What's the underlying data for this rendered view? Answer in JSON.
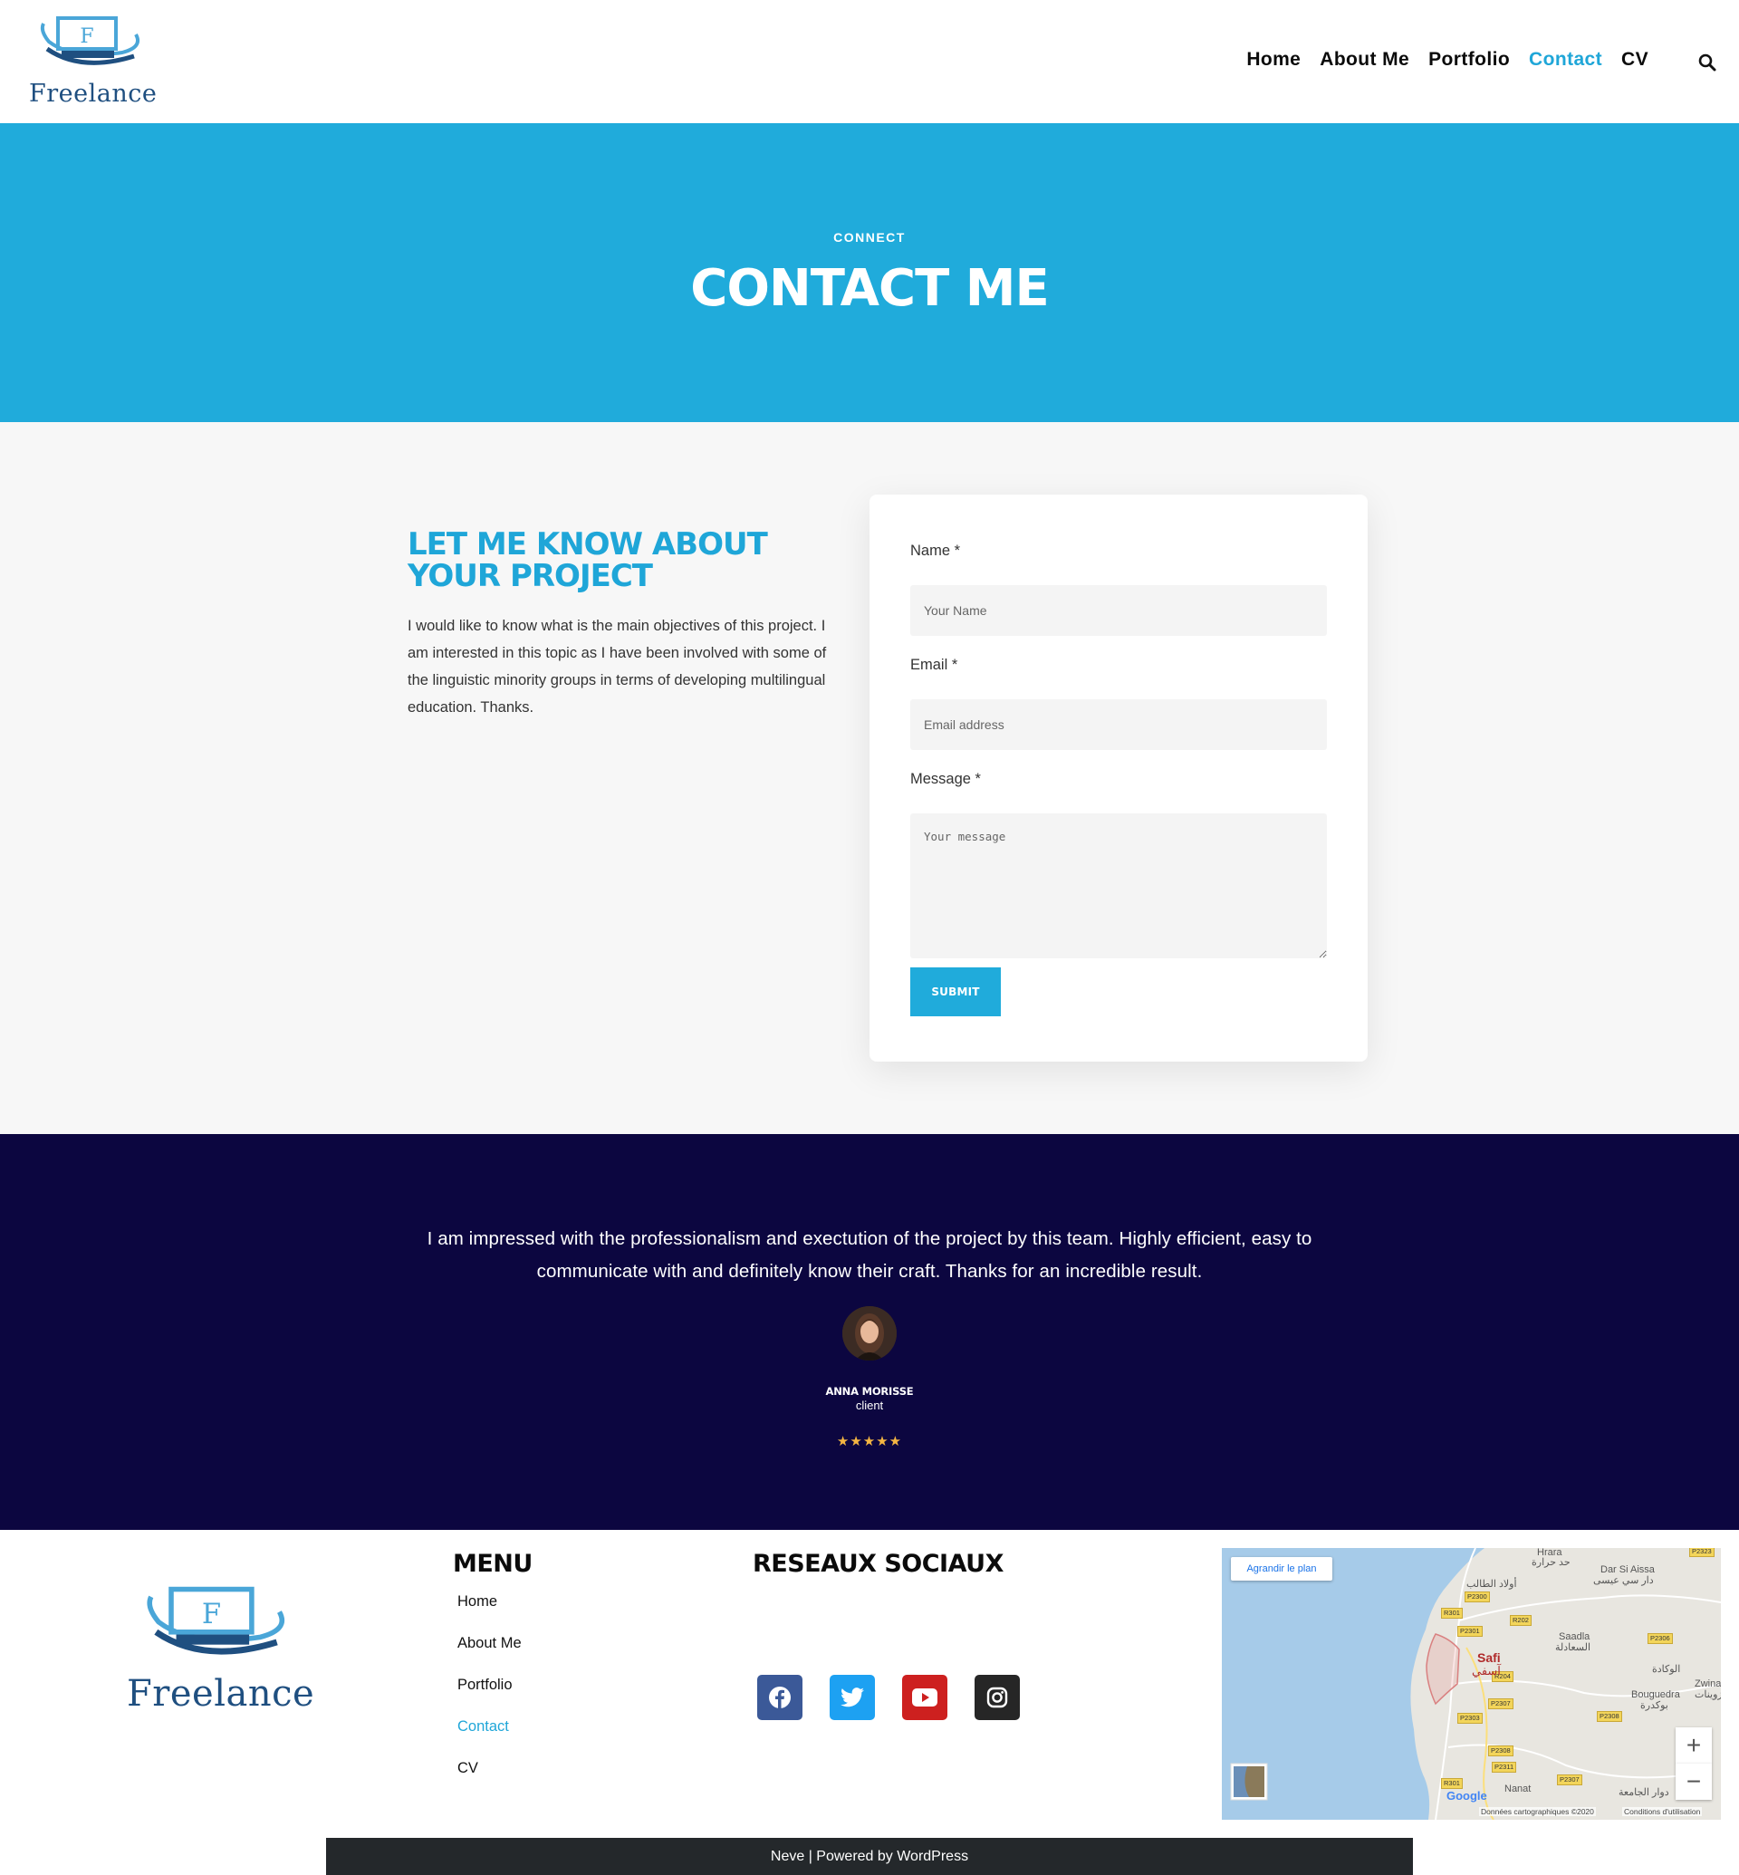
{
  "header": {
    "logo_letter": "F",
    "logo_text": "Freelance",
    "nav": [
      {
        "label": "Home",
        "active": false
      },
      {
        "label": "About Me",
        "active": false
      },
      {
        "label": "Portfolio",
        "active": false
      },
      {
        "label": "Contact",
        "active": true
      },
      {
        "label": "CV",
        "active": false
      }
    ]
  },
  "hero": {
    "kicker": "CONNECT",
    "title": "CONTACT ME"
  },
  "contact": {
    "title": "LET ME KNOW ABOUT YOUR PROJECT",
    "text": "I would like to know what is the main objectives of this project. I am interested in this topic as I have been involved with some of the linguistic minority groups in terms of developing multilingual education. Thanks.",
    "form": {
      "name_label": "Name *",
      "name_placeholder": "Your Name",
      "email_label": "Email *",
      "email_placeholder": "Email address",
      "message_label": "Message *",
      "message_placeholder": "Your message",
      "submit_label": "SUBMIT"
    }
  },
  "testimonial": {
    "quote": "I am impressed with the professionalism and exectution of the project by this team. Highly efficient, easy to communicate with and definitely know their craft. Thanks for an incredible result.",
    "name": "ANNA MORISSE",
    "role": "client",
    "stars": "★★★★★",
    "rating": 5
  },
  "footer": {
    "logo_letter": "F",
    "logo_text": "Freelance",
    "menu_title": "MENU",
    "menu": [
      {
        "label": "Home",
        "active": false
      },
      {
        "label": "About Me",
        "active": false
      },
      {
        "label": "Portfolio",
        "active": false
      },
      {
        "label": "Contact",
        "active": true
      },
      {
        "label": "CV",
        "active": false
      }
    ],
    "social_title": "RESEAUX SOCIAUX",
    "social": [
      {
        "name": "facebook-icon",
        "color": "#3b5998"
      },
      {
        "name": "twitter-icon",
        "color": "#1da1f2"
      },
      {
        "name": "youtube-icon",
        "color": "#cd201f"
      },
      {
        "name": "instagram-icon",
        "color": "#262626"
      }
    ],
    "map": {
      "enlarge_label": "Agrandir le plan",
      "city": "Safi",
      "city_ar": "آسفي",
      "places": [
        "Hrara",
        "حد حرارة",
        "Dar Si Aissa",
        "دار سي عيسى",
        "أولاد الطالب",
        "Saadla",
        "السعادلة",
        "الوكادة",
        "Bouguedra",
        "بوكدرة",
        "Zwina",
        "زوينات",
        "Nanat",
        "دوار الجامعة"
      ],
      "roads": [
        "P2323",
        "P2300",
        "R301",
        "R202",
        "P2301",
        "P2306",
        "R204",
        "P2307",
        "P2303",
        "P2308",
        "P2308",
        "P2311",
        "P2307",
        "R301"
      ],
      "attribution": "Données cartographiques ©2020",
      "terms": "Conditions d'utilisation",
      "google": "Google"
    },
    "credits": "Neve | Powered by WordPress"
  },
  "colors": {
    "accent": "#20abdb",
    "dark_bg": "#0c0640",
    "footer_bar": "#24282b",
    "logo_blue": "#1f4f80"
  }
}
